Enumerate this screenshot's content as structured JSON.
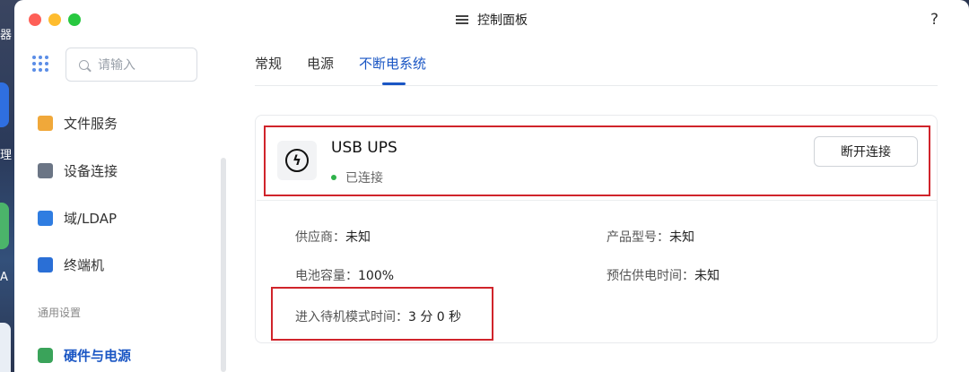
{
  "desktop": {
    "fragment_1": "器",
    "fragment_2": "理",
    "fragment_3": "A"
  },
  "window": {
    "title": "控制面板",
    "help": "?"
  },
  "sidebar": {
    "search_placeholder": "请输入",
    "items": [
      {
        "label": "文件服务",
        "icon": "folder-icon"
      },
      {
        "label": "设备连接",
        "icon": "device-icon"
      },
      {
        "label": "域/LDAP",
        "icon": "domain-icon"
      },
      {
        "label": "终端机",
        "icon": "terminal-icon"
      }
    ],
    "group_label": "通用设置",
    "active_item": {
      "label": "硬件与电源",
      "icon": "battery-icon"
    }
  },
  "tabs": [
    {
      "label": "常规",
      "active": false
    },
    {
      "label": "电源",
      "active": false
    },
    {
      "label": "不断电系统",
      "active": true
    }
  ],
  "ups": {
    "name": "USB UPS",
    "status": "已连接",
    "status_color": "#2fb24a",
    "disconnect_label": "断开连接",
    "vendor_label": "供应商：",
    "vendor_value": "未知",
    "model_label": "产品型号：",
    "model_value": "未知",
    "battery_label": "电池容量：",
    "battery_value": "100%",
    "runtime_label": "预估供电时间：",
    "runtime_value": "未知",
    "standby_label": "进入待机模式时间：",
    "standby_value": "3 分 0 秒"
  },
  "colors": {
    "accent": "#1a56c4",
    "highlight": "#d0242b"
  }
}
